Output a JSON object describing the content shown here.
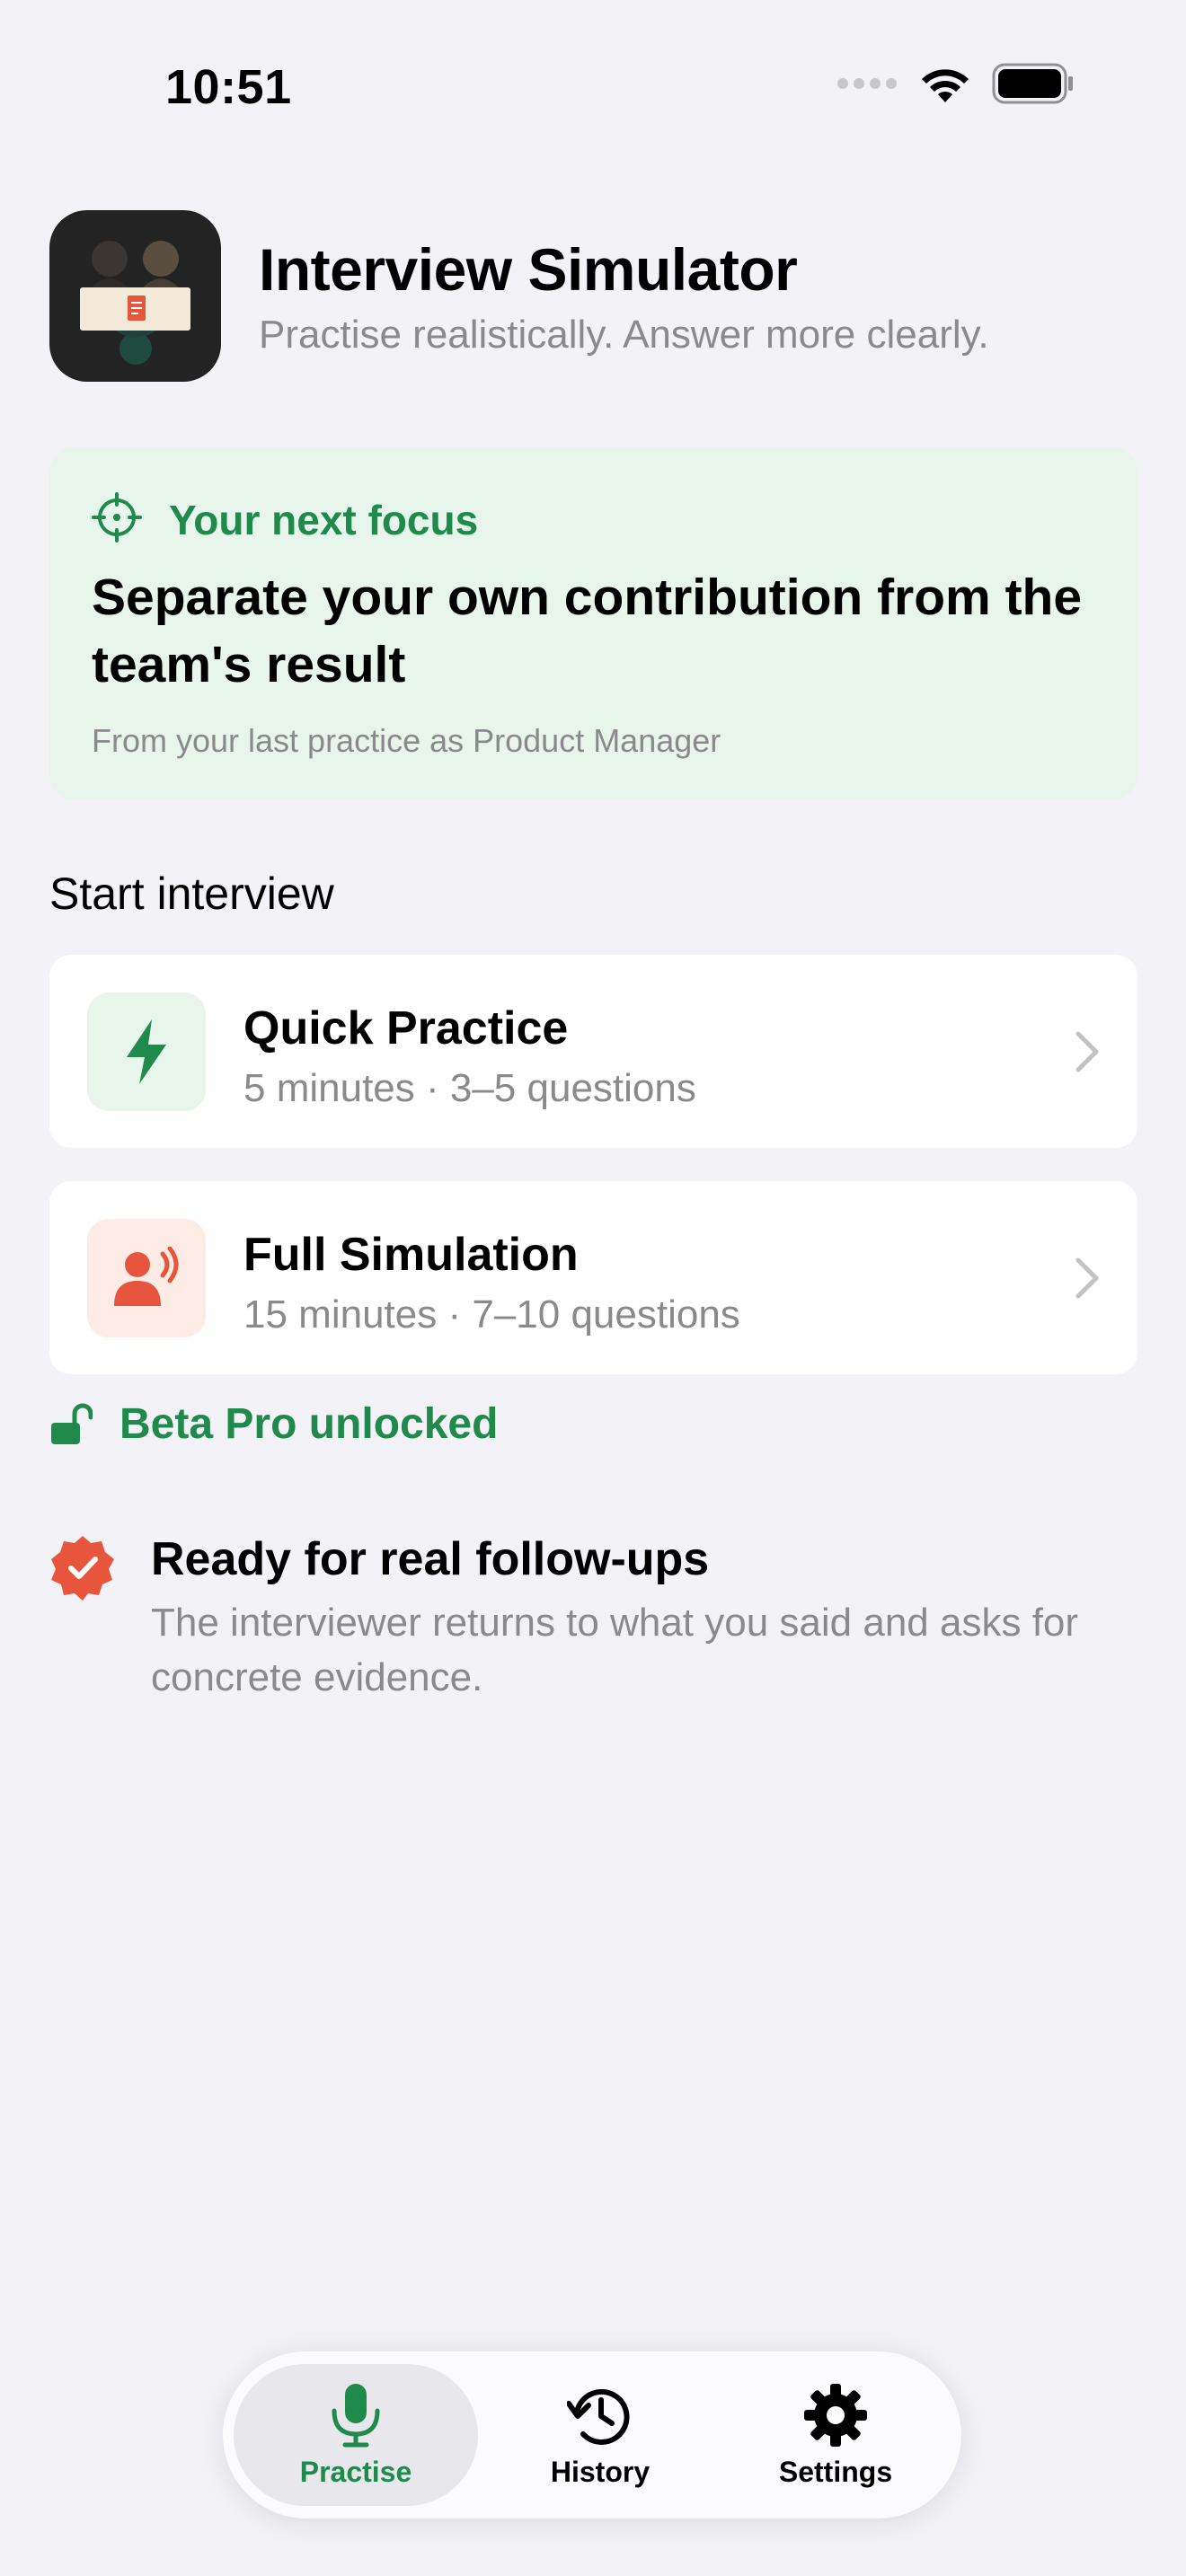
{
  "status_bar": {
    "time": "10:51"
  },
  "header": {
    "title": "Interview Simulator",
    "subtitle": "Practise realistically. Answer more clearly."
  },
  "focus": {
    "label": "Your next focus",
    "text": "Separate your own contribution from the team's result",
    "meta": "From your last practice as Product Manager"
  },
  "start": {
    "title": "Start interview",
    "options": [
      {
        "title": "Quick Practice",
        "subtitle": "5 minutes · 3–5 questions",
        "icon": "bolt-icon"
      },
      {
        "title": "Full Simulation",
        "subtitle": "15 minutes · 7–10 questions",
        "icon": "speaking-person-icon"
      }
    ]
  },
  "beta": {
    "label": "Beta Pro unlocked"
  },
  "ready": {
    "title": "Ready for real follow-ups",
    "text": "The interviewer returns to what you said and asks for concrete evidence."
  },
  "tabbar": {
    "active": "Practise",
    "tabs": [
      {
        "label": "Practise",
        "icon": "microphone-icon"
      },
      {
        "label": "History",
        "icon": "history-icon"
      },
      {
        "label": "Settings",
        "icon": "gear-icon"
      }
    ]
  },
  "colors": {
    "accent_green": "#1f8a4c",
    "accent_red": "#e8553d",
    "focus_bg": "#e7f5ea",
    "page_bg": "#f2f2f7"
  }
}
